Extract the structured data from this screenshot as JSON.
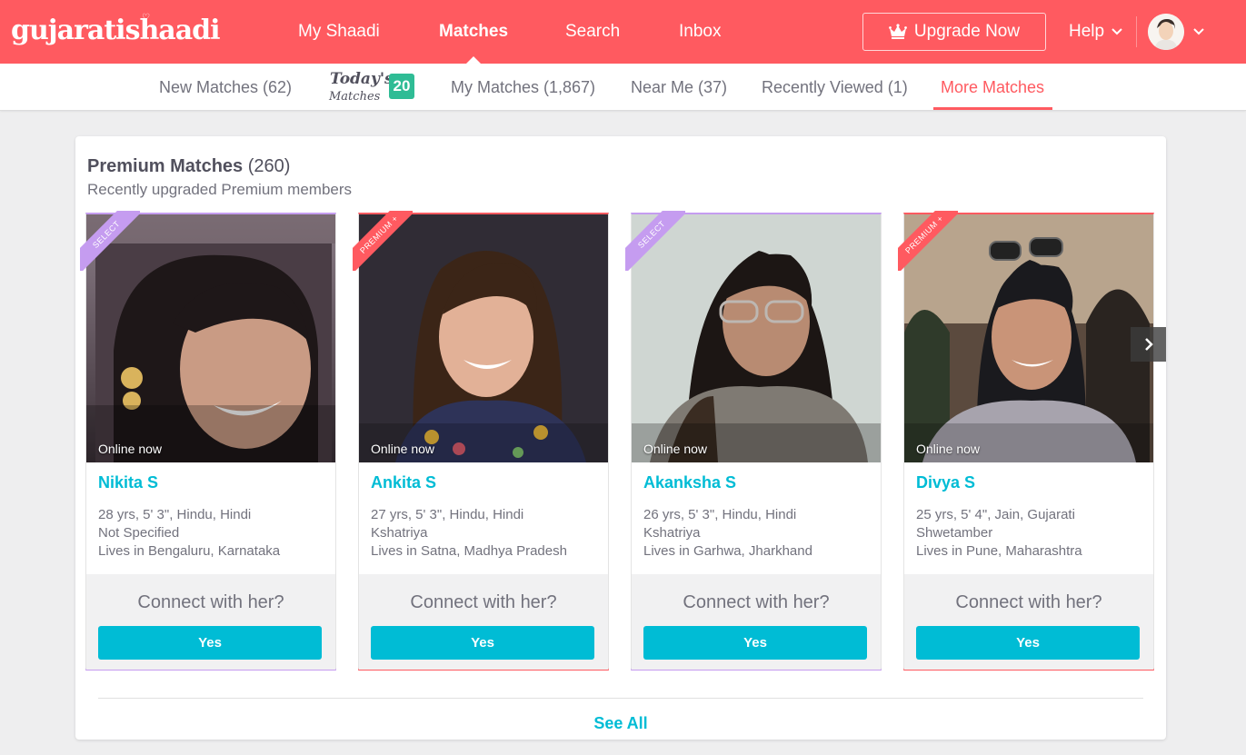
{
  "header": {
    "logo": "gujaratishaadi",
    "nav": [
      "My Shaadi",
      "Matches",
      "Search",
      "Inbox"
    ],
    "active_nav": "Matches",
    "upgrade_label": "Upgrade Now",
    "help_label": "Help"
  },
  "subnav": {
    "new_matches": "New Matches (62)",
    "todays_line1": "Today's",
    "todays_line2": "Matches",
    "todays_count": "20",
    "my_matches": "My Matches (1,867)",
    "near_me": "Near Me (37)",
    "recently_viewed": "Recently Viewed (1)",
    "more_matches": "More Matches",
    "active": "More Matches"
  },
  "section": {
    "title": "Premium Matches",
    "count": "(260)",
    "subtitle": "Recently upgraded Premium members",
    "see_all": "See All"
  },
  "cards": [
    {
      "ribbon": "SELECT",
      "tier": "select",
      "status": "Online now",
      "name": "Nikita S",
      "line1": "28 yrs, 5' 3\", Hindu, Hindi",
      "line2": "Not Specified",
      "line3": "Lives in Bengaluru, Karnataka",
      "connect": "Connect with her?",
      "button": "Yes"
    },
    {
      "ribbon": "PREMIUM +",
      "tier": "premium",
      "status": "Online now",
      "name": "Ankita S",
      "line1": "27 yrs, 5' 3\", Hindu, Hindi",
      "line2": "Kshatriya",
      "line3": "Lives in Satna, Madhya Pradesh",
      "connect": "Connect with her?",
      "button": "Yes"
    },
    {
      "ribbon": "SELECT",
      "tier": "select",
      "status": "Online now",
      "name": "Akanksha S",
      "line1": "26 yrs, 5' 3\", Hindu, Hindi",
      "line2": "Kshatriya",
      "line3": "Lives in Garhwa, Jharkhand",
      "connect": "Connect with her?",
      "button": "Yes"
    },
    {
      "ribbon": "PREMIUM +",
      "tier": "premium",
      "status": "Online now",
      "name": "Divya S",
      "line1": "25 yrs, 5' 4\", Jain, Gujarati",
      "line2": "Shwetamber",
      "line3": "Lives in Pune, Maharashtra",
      "connect": "Connect with her?",
      "button": "Yes"
    }
  ],
  "colors": {
    "brand": "#ff5a60",
    "accent": "#00bcd5",
    "select": "#c59cf0",
    "badge": "#2fbc95"
  }
}
